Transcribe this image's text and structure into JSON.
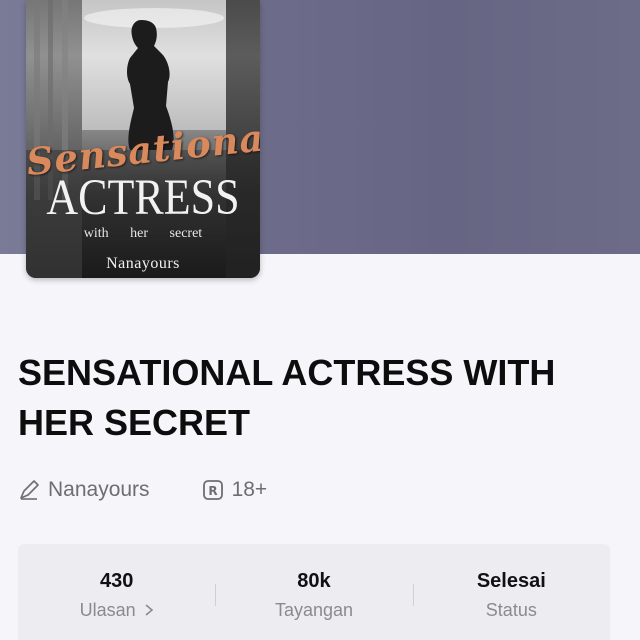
{
  "book": {
    "title": "SENSATIONAL ACTRESS WITH HER SECRET",
    "author": "Nanayours",
    "rating": "18+"
  },
  "cover": {
    "script_title": "Sensational",
    "main_title": "ACTRESS",
    "subtitle": "with her secret",
    "author": "Nanayours"
  },
  "stats": [
    {
      "value": "430",
      "label": "Ulasan"
    },
    {
      "value": "80k",
      "label": "Tayangan"
    },
    {
      "value": "Selesai",
      "label": "Status"
    }
  ],
  "icons": {
    "author": "pen-icon",
    "rating": "r-badge-icon",
    "reviews_more": "chevron-right-icon"
  },
  "colors": {
    "hero": "#6e6e8c",
    "background": "#f6f5fa",
    "stats_panel": "#ececf1",
    "cover_accent": "#d9895c"
  }
}
